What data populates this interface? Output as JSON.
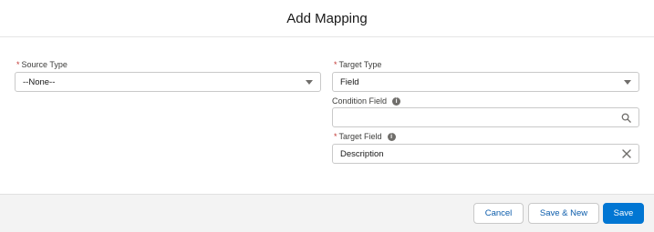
{
  "modal": {
    "title": "Add Mapping"
  },
  "form": {
    "required_marker": "*",
    "source_type": {
      "label": "Source Type",
      "value": "--None--"
    },
    "target_type": {
      "label": "Target Type",
      "value": "Field"
    },
    "condition_field": {
      "label": "Condition Field",
      "value": "",
      "info_glyph": "i"
    },
    "target_field": {
      "label": "Target Field",
      "value": "Description",
      "info_glyph": "i"
    }
  },
  "footer": {
    "cancel_label": "Cancel",
    "save_new_label": "Save & New",
    "save_label": "Save"
  },
  "colors": {
    "brand": "#0176d3",
    "required": "#c23934",
    "link": "#0b5cab"
  },
  "icons": {
    "dropdown": "chevron-down-icon",
    "search": "search-icon",
    "clear": "close-icon",
    "info": "info-icon"
  }
}
